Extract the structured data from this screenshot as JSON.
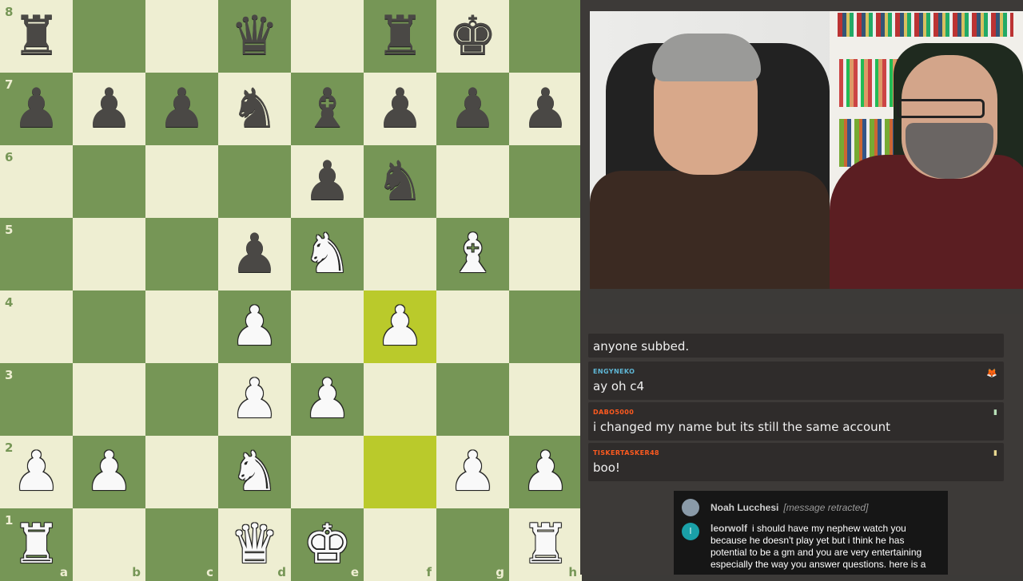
{
  "board": {
    "files": [
      "a",
      "b",
      "c",
      "d",
      "e",
      "f",
      "g",
      "h"
    ],
    "ranks": [
      "8",
      "7",
      "6",
      "5",
      "4",
      "3",
      "2",
      "1"
    ],
    "highlighted": [
      "f4",
      "f2"
    ],
    "pieces": [
      {
        "sq": "a8",
        "glyph": "♜",
        "color": "b",
        "name": "black-rook-a8"
      },
      {
        "sq": "d8",
        "glyph": "♛",
        "color": "b",
        "name": "black-queen-d8"
      },
      {
        "sq": "f8",
        "glyph": "♜",
        "color": "b",
        "name": "black-rook-f8"
      },
      {
        "sq": "g8",
        "glyph": "♚",
        "color": "b",
        "name": "black-king-g8"
      },
      {
        "sq": "a7",
        "glyph": "♟",
        "color": "b",
        "name": "black-pawn-a7"
      },
      {
        "sq": "b7",
        "glyph": "♟",
        "color": "b",
        "name": "black-pawn-b7"
      },
      {
        "sq": "c7",
        "glyph": "♟",
        "color": "b",
        "name": "black-pawn-c7"
      },
      {
        "sq": "d7",
        "glyph": "♞",
        "color": "b",
        "name": "black-knight-d7"
      },
      {
        "sq": "e7",
        "glyph": "♝",
        "color": "b",
        "name": "black-bishop-e7"
      },
      {
        "sq": "f7",
        "glyph": "♟",
        "color": "b",
        "name": "black-pawn-f7"
      },
      {
        "sq": "g7",
        "glyph": "♟",
        "color": "b",
        "name": "black-pawn-g7"
      },
      {
        "sq": "h7",
        "glyph": "♟",
        "color": "b",
        "name": "black-pawn-h7"
      },
      {
        "sq": "e6",
        "glyph": "♟",
        "color": "b",
        "name": "black-pawn-e6"
      },
      {
        "sq": "f6",
        "glyph": "♞",
        "color": "b",
        "name": "black-knight-f6"
      },
      {
        "sq": "d5",
        "glyph": "♟",
        "color": "b",
        "name": "black-pawn-d5"
      },
      {
        "sq": "e5",
        "glyph": "♞",
        "color": "w",
        "name": "white-knight-e5"
      },
      {
        "sq": "g5",
        "glyph": "♝",
        "color": "w",
        "name": "white-bishop-g5"
      },
      {
        "sq": "d4",
        "glyph": "♟",
        "color": "w",
        "name": "white-pawn-d4"
      },
      {
        "sq": "f4",
        "glyph": "♟",
        "color": "w",
        "name": "white-pawn-f4"
      },
      {
        "sq": "d3",
        "glyph": "♟",
        "color": "w",
        "name": "white-pawn-d3"
      },
      {
        "sq": "e3",
        "glyph": "♟",
        "color": "w",
        "name": "white-pawn-e3"
      },
      {
        "sq": "a2",
        "glyph": "♟",
        "color": "w",
        "name": "white-pawn-a2"
      },
      {
        "sq": "b2",
        "glyph": "♟",
        "color": "w",
        "name": "white-pawn-b2"
      },
      {
        "sq": "d2",
        "glyph": "♞",
        "color": "w",
        "name": "white-knight-d2"
      },
      {
        "sq": "g2",
        "glyph": "♟",
        "color": "w",
        "name": "white-pawn-g2"
      },
      {
        "sq": "h2",
        "glyph": "♟",
        "color": "w",
        "name": "white-pawn-h2"
      },
      {
        "sq": "a1",
        "glyph": "♜",
        "color": "w",
        "name": "white-rook-a1"
      },
      {
        "sq": "d1",
        "glyph": "♛",
        "color": "w",
        "name": "white-queen-d1"
      },
      {
        "sq": "e1",
        "glyph": "♚",
        "color": "w",
        "name": "white-king-e1"
      },
      {
        "sq": "h1",
        "glyph": "♜",
        "color": "w",
        "name": "white-rook-h1"
      }
    ]
  },
  "chat": [
    {
      "user": "",
      "text": "anyone subbed.",
      "color": "#ffffff",
      "badge": ""
    },
    {
      "user": "ENGYNEKO",
      "text": "ay oh c4",
      "color": "#5fb7d6",
      "badge": "🦊"
    },
    {
      "user": "DABO5000",
      "text": "i changed my name but its still the same account",
      "color": "#ff5a1f",
      "badge": "▮"
    },
    {
      "user": "TISKERTASKER48",
      "text": "boo!",
      "color": "#ff5a1f",
      "badge": "▮"
    }
  ],
  "youtube_chat": {
    "rows": [
      {
        "name": "Noah Lucchesi",
        "text": "[message retracted]",
        "avatar_color": "#8a9aa8"
      },
      {
        "name": "leorwolf",
        "text": "i should have my nephew watch you because he doesn't play yet but i think he has potential to be a gm and you are very entertaining especially the way you answer questions. here is a",
        "avatar_color": "#1aa0a8",
        "avatar_letter": "l"
      }
    ]
  }
}
